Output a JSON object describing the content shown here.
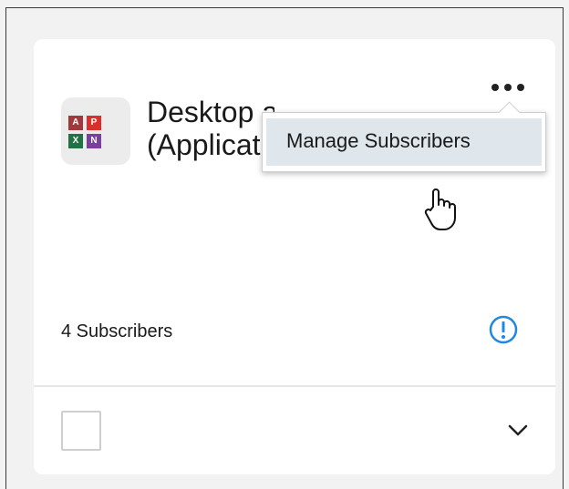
{
  "card": {
    "title_line1": "Desktop and Apps",
    "title_line2": "(Applications)",
    "subscribers_label": "4 Subscribers"
  },
  "menu": {
    "items": [
      {
        "label": "Manage Subscribers"
      }
    ]
  },
  "app_icon": {
    "tiles": [
      "access",
      "pdf",
      "excel",
      "onenote"
    ]
  },
  "colors": {
    "info_accent": "#1e88e5",
    "menu_hover": "#dfe6ec"
  }
}
